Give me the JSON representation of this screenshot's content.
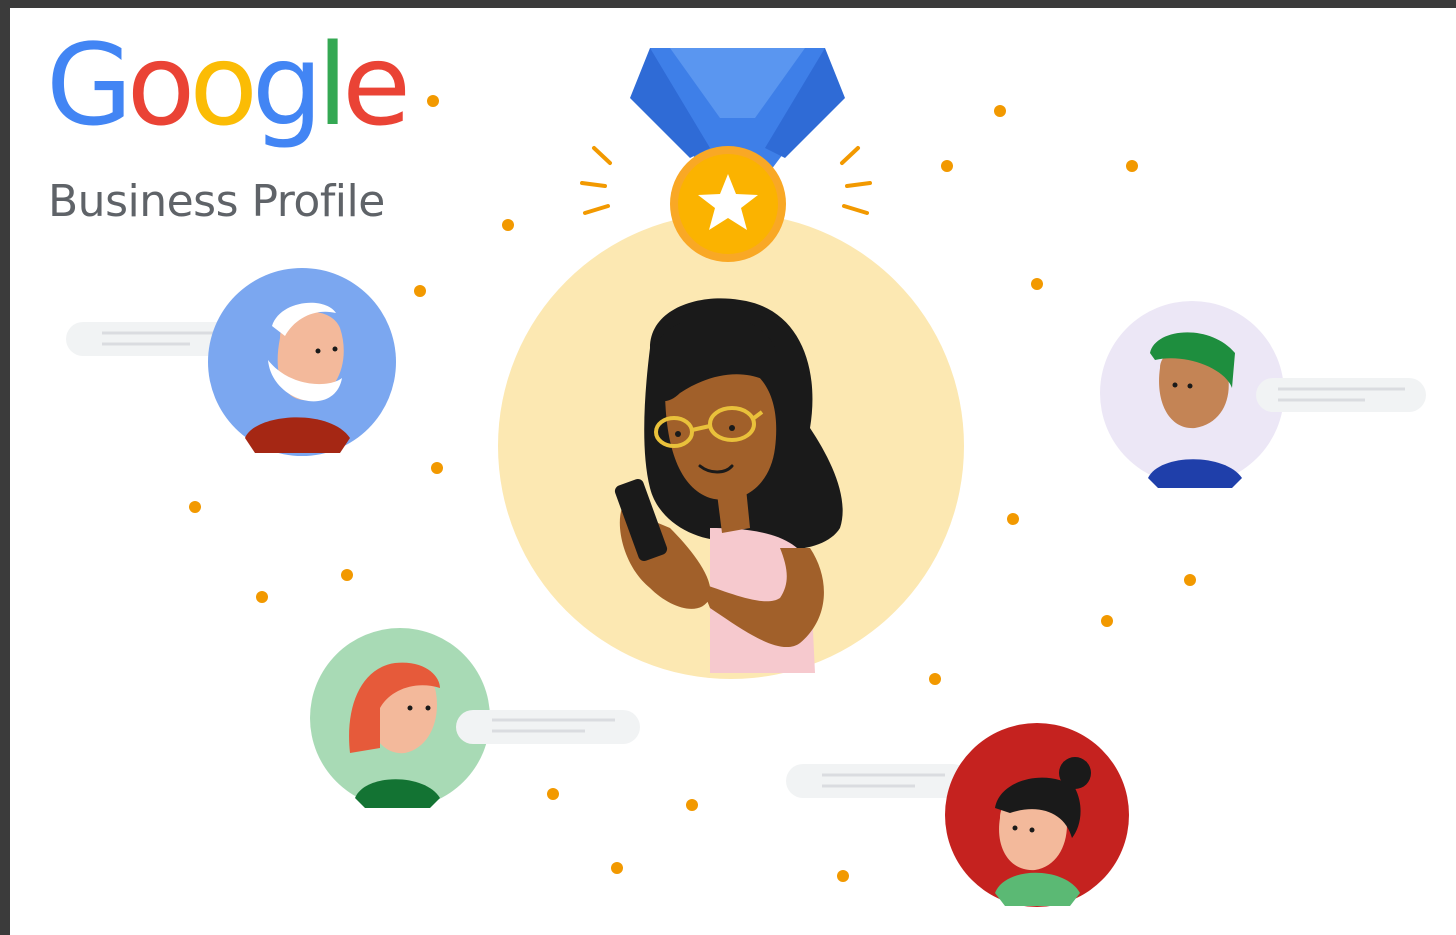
{
  "logo": {
    "letters": [
      {
        "char": "G",
        "color": "#4285F4"
      },
      {
        "char": "o",
        "color": "#EA4335"
      },
      {
        "char": "o",
        "color": "#FBBC05"
      },
      {
        "char": "g",
        "color": "#4285F4"
      },
      {
        "char": "l",
        "color": "#34A853"
      },
      {
        "char": "e",
        "color": "#EA4335"
      }
    ],
    "letter_0": "G",
    "letter_1": "o",
    "letter_2": "o",
    "letter_3": "g",
    "letter_4": "l",
    "letter_5": "e"
  },
  "subtitle": "Business Profile",
  "colors": {
    "blue": "#4285F4",
    "red": "#EA4335",
    "yellow": "#FBBC05",
    "green": "#34A853",
    "dot": "#F29900",
    "halo": "#FCE8B2"
  },
  "illustration": {
    "center_figure": "woman-with-phone",
    "medal_icon": "star-medal-icon",
    "avatars": [
      "elderly-man-avatar",
      "man-green-cap-avatar",
      "woman-red-hair-avatar",
      "woman-dark-bun-avatar"
    ]
  }
}
